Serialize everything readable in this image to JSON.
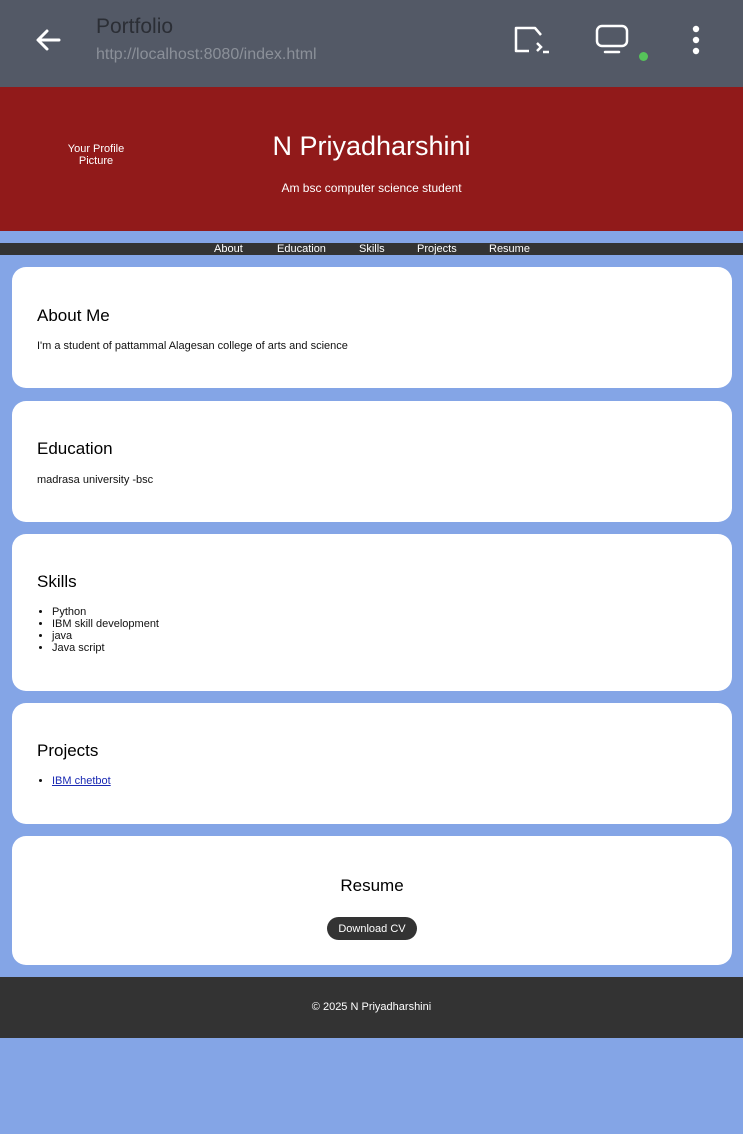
{
  "browser": {
    "title": "Portfolio",
    "url": "http://localhost:8080/index.html",
    "icons": {
      "back": "arrow-left-icon",
      "cast": "cast-icon",
      "tabs": "monitor-icon",
      "menu": "more-vertical-icon"
    },
    "status_color": "#56c35a"
  },
  "header": {
    "profile_alt": "Your Profile Picture",
    "name": "N Priyadharshini",
    "tagline": "Am bsc computer science student",
    "background": "#911a1a"
  },
  "nav": {
    "items": [
      "About",
      "Education",
      "Skills",
      "Projects",
      "Resume"
    ]
  },
  "about": {
    "heading": "About Me",
    "text": "I'm a student of pattammal Alagesan college of arts and science"
  },
  "education": {
    "heading": "Education",
    "text": "madrasa university -bsc"
  },
  "skills": {
    "heading": "Skills",
    "items": [
      "Python",
      "IBM skill development",
      "java",
      "Java script"
    ]
  },
  "projects": {
    "heading": "Projects",
    "items": [
      "IBM chetbot"
    ]
  },
  "resume": {
    "heading": "Resume",
    "button": "Download CV"
  },
  "footer": {
    "text": "© 2025 N Priyadharshini"
  }
}
